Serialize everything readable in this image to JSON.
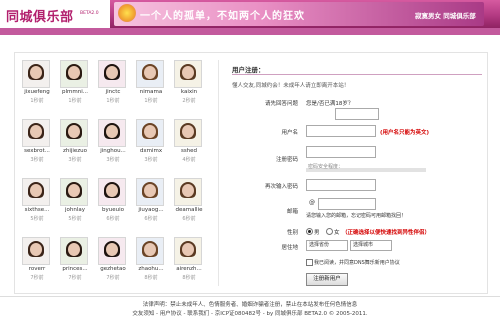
{
  "header": {
    "logo": "同城俱乐部",
    "beta": "BETA2.0",
    "slogan": "一个人的孤单，不如两个人的狂欢",
    "slogan_right": "寂寞男女 同城俱乐部"
  },
  "users": [
    {
      "name": "jixuefeng",
      "time": "1秒前"
    },
    {
      "name": "plmmni...",
      "time": "1秒前"
    },
    {
      "name": "jinctc",
      "time": "1秒前"
    },
    {
      "name": "nimama",
      "time": "1秒前"
    },
    {
      "name": "kaixin",
      "time": "2秒前"
    },
    {
      "name": "sexbrot...",
      "time": "3秒前"
    },
    {
      "name": "zhijiezuo",
      "time": "3秒前"
    },
    {
      "name": "jinghou...",
      "time": "3秒前"
    },
    {
      "name": "dxmimx",
      "time": "3秒前"
    },
    {
      "name": "sshed",
      "time": "4秒前"
    },
    {
      "name": "sixthse...",
      "time": "5秒前"
    },
    {
      "name": "johnlay",
      "time": "5秒前"
    },
    {
      "name": "byueuio",
      "time": "6秒前"
    },
    {
      "name": "jiuyaog...",
      "time": "6秒前"
    },
    {
      "name": "deamallie",
      "time": "6秒前"
    },
    {
      "name": "roverr",
      "time": "7秒前"
    },
    {
      "name": "princes...",
      "time": "7秒前"
    },
    {
      "name": "gezhetao",
      "time": "7秒前"
    },
    {
      "name": "zhaohu...",
      "time": "8秒前"
    },
    {
      "name": "airenzh...",
      "time": "8秒前"
    }
  ],
  "register": {
    "title": "用户注册：",
    "intro": "懂人交友,同城约会！未成年人请立即离开本站！",
    "age_label": "请先回答问题",
    "age_question": "您是/否已满18岁？",
    "username_label": "用户名",
    "username_hint": "(用户名只能为英文)",
    "password_label": "注册密码",
    "password_strength": "密码安全程度：",
    "confirm_label": "再次输入密码",
    "email_label": "邮箱",
    "email_at": "@",
    "email_hint": "请您输入您的邮箱，忘记密码可用邮箱找回！",
    "gender_label": "性别",
    "gender_male": "男",
    "gender_female": "女",
    "gender_hint": "（正确选择以便快速找到异性伴侣）",
    "location_label": "居住地",
    "province_placeholder": "选择省份",
    "city_placeholder": "选择城市",
    "agree_text": "我已阅读，并同意DNS舞乐新用户协议",
    "submit": "注册新用户"
  },
  "footer": {
    "line1": "法律声明：禁止未成年人、色情服务者、婚姻诈骗者注册，禁止在本站发布任何色情信息",
    "line2": "交友须知 - 用户协议 - 联系我们 - 京ICP证080482号 - by 同城俱乐部 BETA2.0 © 2005-2011."
  }
}
